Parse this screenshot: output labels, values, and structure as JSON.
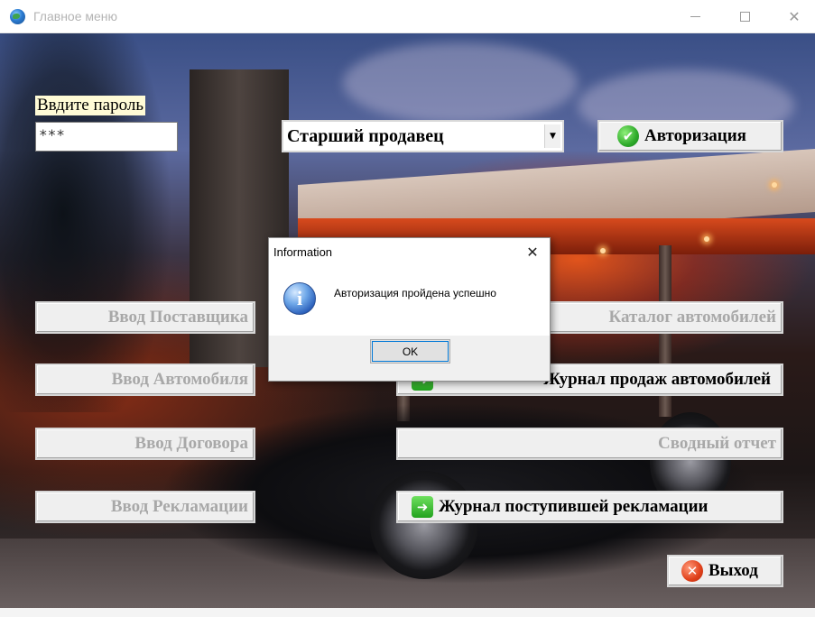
{
  "window": {
    "title": "Главное меню",
    "controls": {
      "minimize": "—",
      "maximize": "☐",
      "close": "✕"
    }
  },
  "login": {
    "password_label": "Ввдите пароль",
    "password_value": "***",
    "role_selected": "Старший продавец",
    "auth_button": "Авторизация"
  },
  "menu": {
    "left": [
      {
        "label": "Ввод Поставщика",
        "enabled": false
      },
      {
        "label": "Ввод Автомобиля",
        "enabled": false
      },
      {
        "label": "Ввод Договора",
        "enabled": false
      },
      {
        "label": "Ввод Рекламации",
        "enabled": false
      }
    ],
    "right": [
      {
        "label": "Каталог автомобилей",
        "enabled": false
      },
      {
        "label": "Журнал продаж автомобилей",
        "enabled": true
      },
      {
        "label": "Сводный отчет",
        "enabled": false
      },
      {
        "label": "Журнал поступившей рекламации",
        "enabled": true
      }
    ],
    "exit_button": "Выход"
  },
  "dialog": {
    "title": "Information",
    "message": "Авторизация пройдена успешно",
    "ok_label": "OK",
    "icon": "info-icon"
  },
  "colors": {
    "disabled_text": "#a8a8a8",
    "button_bg": "#efefef",
    "label_bg": "#fffbd6"
  }
}
